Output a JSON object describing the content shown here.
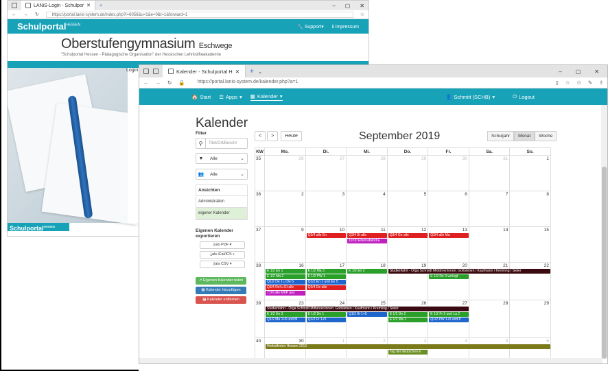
{
  "back_window": {
    "tab_title": "LANiS-Login - Schulpor",
    "url": "https://portal.lanis-system.de/index.php?i=6056&u=1&e=0&t=1&forward=1",
    "brand": "Schulportal",
    "brand_sup": "HESSEN",
    "support": "Support",
    "impressum": "Impressum",
    "school_name": "Oberstufengymnasium",
    "school_city": "Eschwege",
    "school_sub": "\"Schulportal Hessen - Pädagogische Organisation\" der Hessischen Lehrkräfteakademie",
    "login_label": "Login",
    "footer_brand": "Schulportal",
    "footer_sup": "HESSEN"
  },
  "front_window": {
    "tab_title": "Kalender - Schulportal H",
    "url": "https://portal.lanis-system.de/kalender.php?a=1",
    "nav": {
      "start": "Start",
      "apps": "Apps",
      "kalender": "Kalender",
      "user": "Schmitt (SCHB)",
      "logout": "Logout"
    }
  },
  "sidebar": {
    "page_title": "Kalender",
    "filter_label": "Filter",
    "search_placeholder": "Titel/Ort/Beschr",
    "select1": "Alle",
    "select2": "Alle",
    "views_header": "Ansichten",
    "view_admin": "Administration",
    "view_own": "eigener Kalender",
    "export_title": "Eigenen Kalender exportieren",
    "export_pdf": "als PDF",
    "export_ical": "als iCal/ICS",
    "export_csv": "als CSV",
    "btn_share": "Eigenen Kalender teilen",
    "btn_add": "Kalender hinzufügen",
    "btn_remove": "Kalender entfernen"
  },
  "calendar": {
    "prev": "<",
    "next": ">",
    "today": "Heute",
    "month_title": "September 2019",
    "view_year": "Schuljahr",
    "view_month": "Monat",
    "view_week": "Woche",
    "headers": [
      "KW",
      "Mo.",
      "Di.",
      "Mi.",
      "Do.",
      "Fr.",
      "Sa.",
      "So."
    ],
    "weeks": [
      {
        "kw": "35",
        "days": [
          "26",
          "27",
          "28",
          "29",
          "30",
          "31",
          "1"
        ],
        "other": [
          true,
          true,
          true,
          true,
          true,
          true,
          false
        ]
      },
      {
        "kw": "36",
        "days": [
          "2",
          "3",
          "4",
          "5",
          "6",
          "7",
          "8"
        ],
        "other": [
          false,
          false,
          false,
          false,
          false,
          false,
          false
        ]
      },
      {
        "kw": "37",
        "days": [
          "9",
          "10",
          "11",
          "12",
          "13",
          "14",
          "15"
        ],
        "other": [
          false,
          false,
          false,
          false,
          false,
          false,
          false
        ]
      },
      {
        "kw": "38",
        "days": [
          "16",
          "17",
          "18",
          "19",
          "20",
          "21",
          "22"
        ],
        "other": [
          false,
          false,
          false,
          false,
          false,
          false,
          false
        ]
      },
      {
        "kw": "39",
        "days": [
          "23",
          "24",
          "25",
          "26",
          "27",
          "28",
          "29"
        ],
        "other": [
          false,
          false,
          false,
          false,
          false,
          false,
          false
        ]
      },
      {
        "kw": "40",
        "days": [
          "30",
          "1",
          "2",
          "3",
          "4",
          "5",
          "6"
        ],
        "other": [
          false,
          true,
          true,
          true,
          true,
          true,
          true
        ]
      }
    ],
    "events": [
      {
        "w": 2,
        "d": 1,
        "r": 0,
        "span": 1,
        "text": "Q3/4 alle En",
        "color": "#e02020"
      },
      {
        "w": 2,
        "d": 2,
        "r": 0,
        "span": 1,
        "text": "Q3/4 Bi alle",
        "color": "#e02020"
      },
      {
        "w": 2,
        "d": 2,
        "r": 1,
        "span": 1,
        "text": "19:00 Elternabend E",
        "color": "#c020c0"
      },
      {
        "w": 2,
        "d": 3,
        "r": 0,
        "span": 1,
        "text": "Q3/4 Ge alle",
        "color": "#e02020"
      },
      {
        "w": 2,
        "d": 4,
        "r": 0,
        "span": 1,
        "text": "Q3/4 alle Ma",
        "color": "#e02020"
      },
      {
        "w": 3,
        "d": 0,
        "r": 0,
        "span": 1,
        "text": "E 1/2 En 1",
        "color": "#2aa02a"
      },
      {
        "w": 3,
        "d": 1,
        "r": 0,
        "span": 1,
        "text": "E 1/2 Ma 3",
        "color": "#2aa02a"
      },
      {
        "w": 3,
        "d": 2,
        "r": 0,
        "span": 1,
        "text": "E 1/2 En 2",
        "color": "#2aa02a"
      },
      {
        "w": 3,
        "d": 3,
        "r": 0,
        "span": 4,
        "text": "Studienfahrt - Orga Schmidt Mitfahrer/innen: Gottsleben / Kaufmann / Kremlıng / Sieler",
        "color": "#3a0a10"
      },
      {
        "w": 3,
        "d": 0,
        "r": 1,
        "span": 1,
        "text": "E 1/2 Ma 2",
        "color": "#2aa02a"
      },
      {
        "w": 3,
        "d": 1,
        "r": 1,
        "span": 1,
        "text": "E 1/2 PW 1",
        "color": "#2aa02a"
      },
      {
        "w": 3,
        "d": 4,
        "r": 1,
        "span": 1,
        "text": "E 1/2 De 3 verlegt",
        "color": "#2aa02a"
      },
      {
        "w": 3,
        "d": 0,
        "r": 2,
        "span": 1,
        "text": "Q1/2 De 1 u De 5",
        "color": "#1f66cc"
      },
      {
        "w": 3,
        "d": 1,
        "r": 2,
        "span": 1,
        "text": "Q1/2 En 1 und En 5",
        "color": "#1f66cc"
      },
      {
        "w": 3,
        "d": 0,
        "r": 3,
        "span": 1,
        "text": "Q3/4 Rel u Et alle",
        "color": "#e02020"
      },
      {
        "w": 3,
        "d": 1,
        "r": 3,
        "span": 1,
        "text": "Q3/4 De alle",
        "color": "#e02020"
      },
      {
        "w": 3,
        "d": 0,
        "r": 4,
        "span": 1,
        "text": "7:00 alle MKP aus",
        "color": "#c020c0"
      },
      {
        "w": 4,
        "d": 0,
        "r": 0,
        "span": 5,
        "text": "Studienfahrt - Orga Schmidt Mitfahrer/innen: Gottsleben / Kaufmann / Kremlıng / Sieler",
        "color": "#3a0a10"
      },
      {
        "w": 4,
        "d": 0,
        "r": 1,
        "span": 1,
        "text": "E 1/2 En 3",
        "color": "#2aa02a"
      },
      {
        "w": 4,
        "d": 1,
        "r": 1,
        "span": 1,
        "text": "E 1/2 De 1",
        "color": "#2aa02a"
      },
      {
        "w": 4,
        "d": 2,
        "r": 1,
        "span": 1,
        "text": "Q1/2 Bi 1+5",
        "color": "#1f66cc"
      },
      {
        "w": 4,
        "d": 3,
        "r": 1,
        "span": 1,
        "text": "E 1/2 De 2",
        "color": "#2aa02a"
      },
      {
        "w": 4,
        "d": 4,
        "r": 1,
        "span": 1,
        "text": "E 1/2 Fr 2 und La 2",
        "color": "#2aa02a"
      },
      {
        "w": 4,
        "d": 0,
        "r": 2,
        "span": 1,
        "text": "Q1/2 Ma 1+6 und M",
        "color": "#1f66cc"
      },
      {
        "w": 4,
        "d": 1,
        "r": 2,
        "span": 1,
        "text": "Q1/2 Fr 1+5",
        "color": "#1f66cc"
      },
      {
        "w": 4,
        "d": 3,
        "r": 2,
        "span": 1,
        "text": "E 1/2 Ma 1",
        "color": "#2aa02a"
      },
      {
        "w": 4,
        "d": 4,
        "r": 2,
        "span": 1,
        "text": "Q1/2 PW 1+5 und P",
        "color": "#1f66cc"
      },
      {
        "w": 5,
        "d": 0,
        "r": 0,
        "span": 7,
        "text": "Herbstferien Hessen 2019",
        "color": "#7a7a1a"
      },
      {
        "w": 5,
        "d": 3,
        "r": 1,
        "span": 1,
        "text": "Tag der deutschen E",
        "color": "#6b8e23"
      }
    ]
  }
}
